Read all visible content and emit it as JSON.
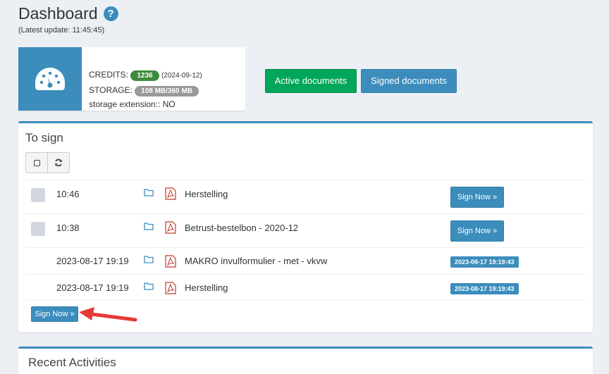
{
  "header": {
    "title": "Dashboard",
    "help_icon": "?",
    "last_update": "(Latest update: 11:45:45)"
  },
  "info_box": {
    "icon": "dashboard-gauge-icon",
    "credits_label": "CREDITS:",
    "credits_value": "1236",
    "credits_date": "(2024-09-12)",
    "storage_label": "STORAGE:",
    "storage_value": "108 MB/360 MB",
    "storage_extension": "storage extension:: NO"
  },
  "buttons": {
    "active_documents": "Active documents",
    "signed_documents": "Signed documents"
  },
  "to_sign": {
    "title": "To sign",
    "rows": [
      {
        "time": "10:46",
        "name": "Herstelling",
        "action": "Sign Now »",
        "checkbox": true
      },
      {
        "time": "10:38",
        "name": "Betrust-bestelbon - 2020-12",
        "action": "Sign Now »",
        "checkbox": true
      },
      {
        "time": "2023-08-17 19:19",
        "name": "MAKRO invulformulier - met - vkvw",
        "badge": "2023-08-17 19:19:43",
        "checkbox": false
      },
      {
        "time": "2023-08-17 19:19",
        "name": "Herstelling",
        "badge": "2023-08-17 19:19:43",
        "checkbox": false
      }
    ],
    "bottom_button": "Sign Now »"
  },
  "recent": {
    "title": "Recent Activities"
  },
  "colors": {
    "primary": "#3c8dbc",
    "success": "#00a65a",
    "annotation_arrow": "#e53935"
  }
}
